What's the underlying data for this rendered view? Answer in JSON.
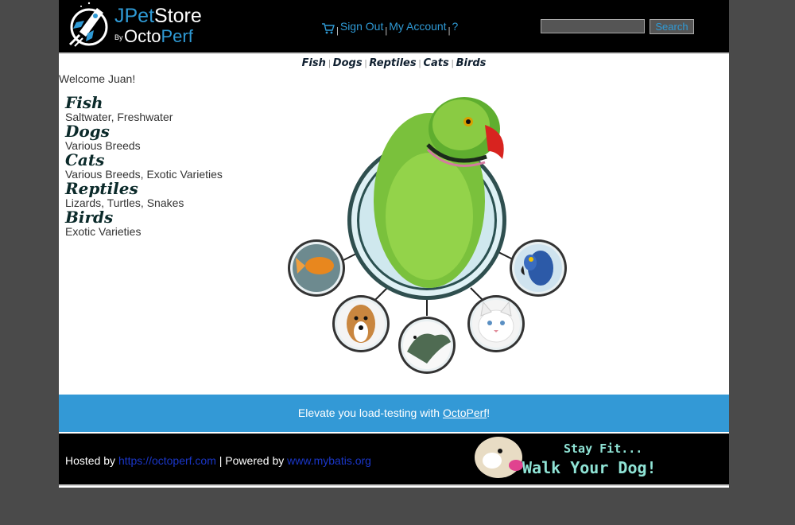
{
  "header": {
    "logo_part1": "J",
    "logo_part2": "Pet",
    "logo_part3": "Store",
    "logo_by": "By",
    "logo_octo": "Octo",
    "logo_perf": "Perf",
    "menu": {
      "cart_icon": "cart-icon",
      "sign_out": "Sign Out",
      "my_account": "My Account",
      "help": "?",
      "separator": "|"
    },
    "search": {
      "value": "",
      "button_label": "Search"
    }
  },
  "quicklinks": [
    "Fish",
    "Dogs",
    "Reptiles",
    "Cats",
    "Birds"
  ],
  "welcome": "Welcome Juan!",
  "sidebar": {
    "categories": [
      {
        "name": "Fish",
        "desc": "Saltwater, Freshwater"
      },
      {
        "name": "Dogs",
        "desc": "Various Breeds"
      },
      {
        "name": "Cats",
        "desc": "Various Breeds, Exotic Varieties"
      },
      {
        "name": "Reptiles",
        "desc": "Lizards, Turtles, Snakes"
      },
      {
        "name": "Birds",
        "desc": "Exotic Varieties"
      }
    ]
  },
  "banner": {
    "prefix": "Elevate you load-testing with ",
    "link": "OctoPerf",
    "suffix": "!"
  },
  "footer": {
    "hosted_by": "Hosted by ",
    "hosted_link": "https://octoperf.com",
    "powered_by": " | Powered by ",
    "powered_link": "www.mybatis.org",
    "ad_line1": "Stay Fit...",
    "ad_line2": "Walk Your Dog!"
  },
  "colors": {
    "accent": "#2f9ad5",
    "banner": "#3399d6",
    "header_bg": "#000000",
    "page_bg": "#4a4a4a"
  }
}
